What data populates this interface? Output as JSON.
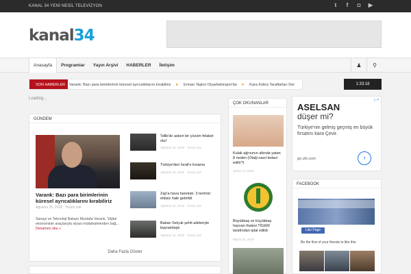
{
  "topbar": {
    "tagline": "KANAL 34 YENİ NESİL TELEVİZYON",
    "social": [
      {
        "icon": "twitter-icon",
        "glyph": "t"
      },
      {
        "icon": "facebook-icon",
        "glyph": "f"
      },
      {
        "icon": "instagram-icon",
        "glyph": "◘"
      },
      {
        "icon": "youtube-icon",
        "glyph": "▶"
      }
    ]
  },
  "logo": {
    "text": "kanal",
    "num": "34"
  },
  "nav": {
    "items": [
      "Anasayfa",
      "Programlar",
      "Yayın Arşivi",
      "HABERLER",
      "İletişim"
    ],
    "active": "Anasayfa"
  },
  "ticker": {
    "label": "SON HABERLER",
    "items": [
      "Varank: Bazı para birimlerinin küresel ayrıcalıklarını kırabiliriz",
      "Erman Taşkın Diyarbekirspor'da",
      "Kara Kobra Taraftarları Der"
    ]
  },
  "clock": "1:33:18",
  "loading": "Loading...",
  "gundem": {
    "title": "GÜNDEM",
    "main": {
      "title": "Varank: Bazı para birimlerinin küresel ayrıcalıklarını kırabiliriz",
      "date": "Ağustos 25, 2018",
      "comments": "Yorum yok",
      "excerpt": "Sanayi ve Teknoloji Bakanı Mustafa Varank, 'Dijital ekonominin araçlarıyla siyasi müdahalelerden bağ... ",
      "more": "Devamını oku »"
    },
    "side": [
      {
        "title": "'İdlib'de askeri bir çözüm felaket olur'",
        "date": "Ağustos 24, 2018",
        "comments": "Yorum yok"
      },
      {
        "title": "Türkiye'den İsrail'e kınama",
        "date": "Ağustos 24, 2018",
        "comments": "Yorum yok"
      },
      {
        "title": "Zap'a hava harekatı: 3 terörist etkisiz hale getirildi",
        "date": "Ağustos 24, 2018",
        "comments": "Yorum yok"
      },
      {
        "title": "Bakan Selçuk şehit aileleriyle bayramlaştı",
        "date": "Ağustos 24, 2018",
        "comments": "Yorum yok"
      }
    ],
    "more_button": "Daha Fazla Göster"
  },
  "cok_okunanlar": {
    "title": "ÇOK OKUNANLAR",
    "items": [
      {
        "title": "Kulak ağrısının altında yatan 8 neden (Otalji nasıl tedavi edilir?)",
        "date": "Şubat 14, 2018"
      },
      {
        "title": "Büyükbaş ve küçükbaş hayvan ihalesi TİGEM tarafından iptal edildi",
        "date": "Mayıs 22, 2018"
      }
    ],
    "tigem_label": "TIGEM"
  },
  "ad": {
    "headline": "ASELSAN",
    "headline2": "düşer mi?",
    "body": "Türkiye'nin gelmiş geçmiş en büyük fırsatını kara Çevir.",
    "domain": "go.ufx.com",
    "arrow": "›",
    "choices": "▷✕"
  },
  "facebook": {
    "title": "FACEBOOK",
    "like": "Like Page",
    "text": "Be the first of your friends to like this"
  },
  "colors": {
    "accent": "#b5121b",
    "logo_blue": "#1aa1d7",
    "topbar": "#2b2b2b"
  }
}
